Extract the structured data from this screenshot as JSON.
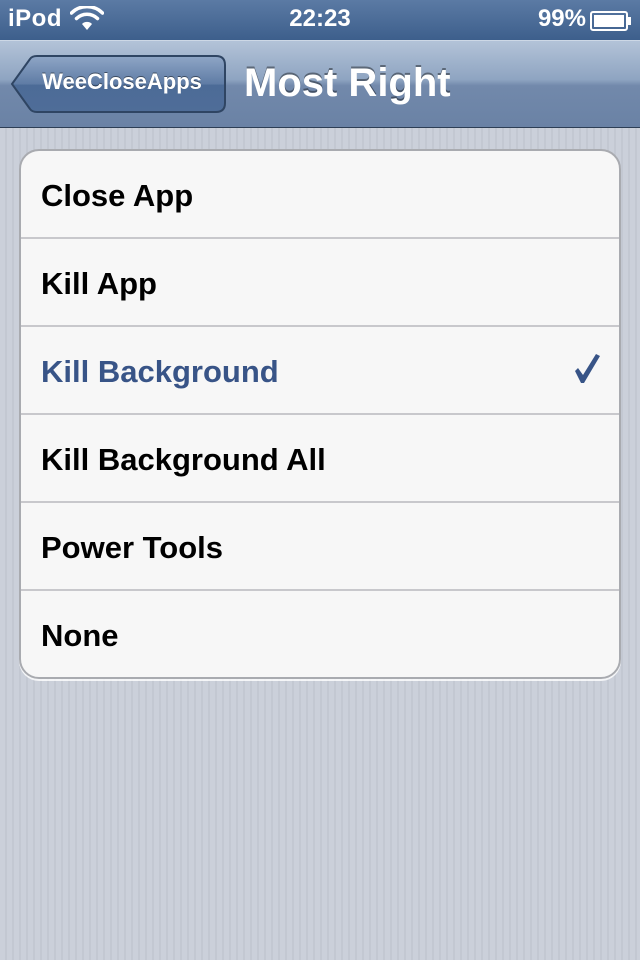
{
  "status_bar": {
    "carrier": "iPod",
    "time": "22:23",
    "battery_percent": "99%",
    "wifi_icon": "wifi-icon",
    "battery_icon": "battery-icon"
  },
  "nav_bar": {
    "back_label": "WeeCloseApps",
    "title": "Most Right"
  },
  "options": [
    {
      "label": "Close App",
      "selected": false
    },
    {
      "label": "Kill App",
      "selected": false
    },
    {
      "label": "Kill Background",
      "selected": true
    },
    {
      "label": "Kill Background All",
      "selected": false
    },
    {
      "label": "Power Tools",
      "selected": false
    },
    {
      "label": "None",
      "selected": false
    }
  ],
  "colors": {
    "selected_text": "#385487",
    "nav_bar": "#6a82a5",
    "status_bar": "#3d5f8c"
  },
  "checkmark_icon": "checkmark-icon"
}
